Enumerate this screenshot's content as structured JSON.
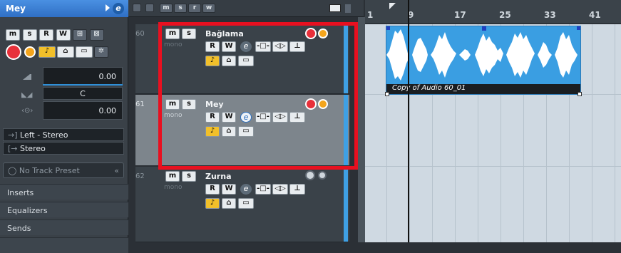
{
  "inspector": {
    "track_name": "Mey",
    "buttons_top": [
      "m",
      "s",
      "R",
      "W"
    ],
    "volume_value": "0.00",
    "pan_value": "C",
    "delay_value": "0.00",
    "input_routing": "Left - Stereo",
    "output_routing": "Stereo",
    "preset_placeholder": "No Track Preset",
    "sections": [
      "Inserts",
      "Equalizers",
      "Sends"
    ]
  },
  "toolbar": {
    "buttons": [
      "m",
      "s",
      "r",
      "w"
    ]
  },
  "tracks": [
    {
      "number": "60",
      "name": "Bağlama",
      "mono": "mono"
    },
    {
      "number": "61",
      "name": "Mey",
      "mono": "mono"
    },
    {
      "number": "62",
      "name": "Zurna",
      "mono": "mono"
    }
  ],
  "track_buttons": {
    "m": "m",
    "s": "s",
    "r": "R",
    "w": "W",
    "e": "e"
  },
  "ruler": {
    "bars": [
      "1",
      "9",
      "17",
      "25",
      "33",
      "41"
    ]
  },
  "event": {
    "label": "Copy of Audio 60_01"
  },
  "colors": {
    "accent": "#3fa0e4",
    "selection": "#e81020",
    "record": "#e8303a",
    "monitor": "#f4a51c"
  }
}
